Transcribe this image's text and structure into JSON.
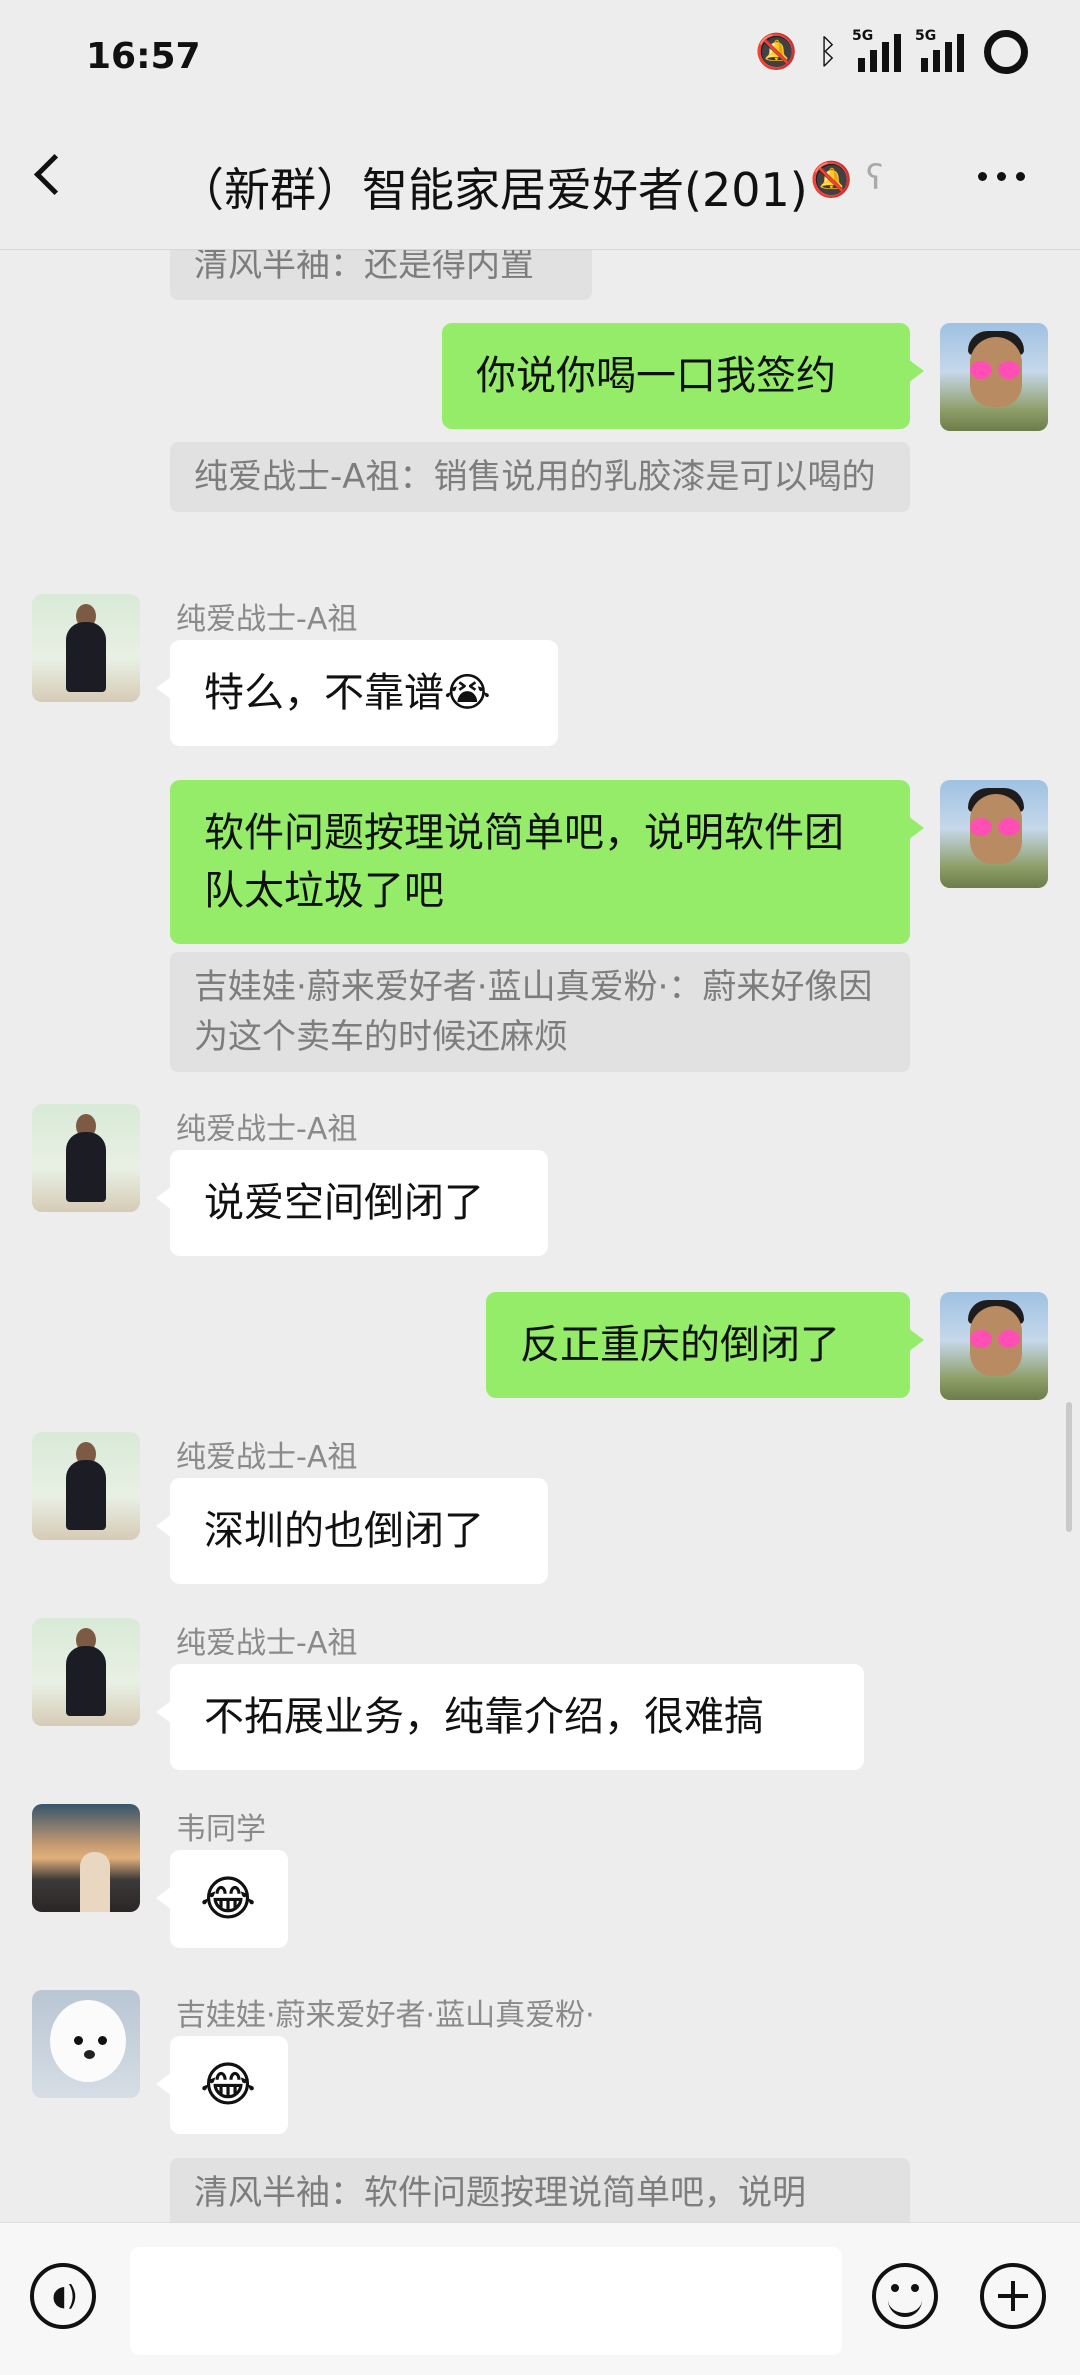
{
  "status_bar": {
    "time": "16:57",
    "icons": [
      "bell-muted-icon",
      "bluetooth-icon",
      "signal-5g-icon",
      "signal-5g-icon",
      "battery-ring-icon"
    ],
    "network_label": "5G"
  },
  "nav": {
    "back_icon": "chevron-left-icon",
    "title": "（新群）智能家居爱好者(201)",
    "mute_icon": "bell-muted-icon",
    "ear_icon": "ear-icon",
    "more_icon": "more-dots-icon"
  },
  "messages": {
    "top_quote": "清风半袖：还是得内置",
    "m1_text": "你说你喝一口我签约",
    "m1_quote": "纯爱战士-A祖：销售说用的乳胶漆是可以喝的",
    "m2_sender": "纯爱战士-A祖",
    "m2_text": "特么，不靠谱😭",
    "m3_text": "软件问题按理说简单吧，说明软件团队太垃圾了吧",
    "m3_quote": "吉娃娃·蔚来爱好者·蓝山真爱粉·：蔚来好像因为这个卖车的时候还麻烦",
    "m4_sender": "纯爱战士-A祖",
    "m4_text": "说爱空间倒闭了",
    "m5_text": "反正重庆的倒闭了",
    "m6_sender": "纯爱战士-A祖",
    "m6_text": "深圳的也倒闭了",
    "m7_sender": "纯爱战士-A祖",
    "m7_text": "不拓展业务，纯靠介绍，很难搞",
    "m8_sender": "韦同学",
    "m8_text": "😂",
    "m9_sender": "吉娃娃·蔚来爱好者·蓝山真爱粉·",
    "m9_text": "😂",
    "bottom_quote": "清风半袖：软件问题按理说简单吧，说明"
  },
  "input_bar": {
    "voice_icon": "voice-icon",
    "emoji_icon": "emoji-icon",
    "plus_icon": "plus-icon",
    "text_value": ""
  },
  "colors": {
    "background": "#ededed",
    "outgoing_bubble": "#95ec69",
    "incoming_bubble": "#ffffff",
    "quote_bg": "#e1e1e1"
  }
}
